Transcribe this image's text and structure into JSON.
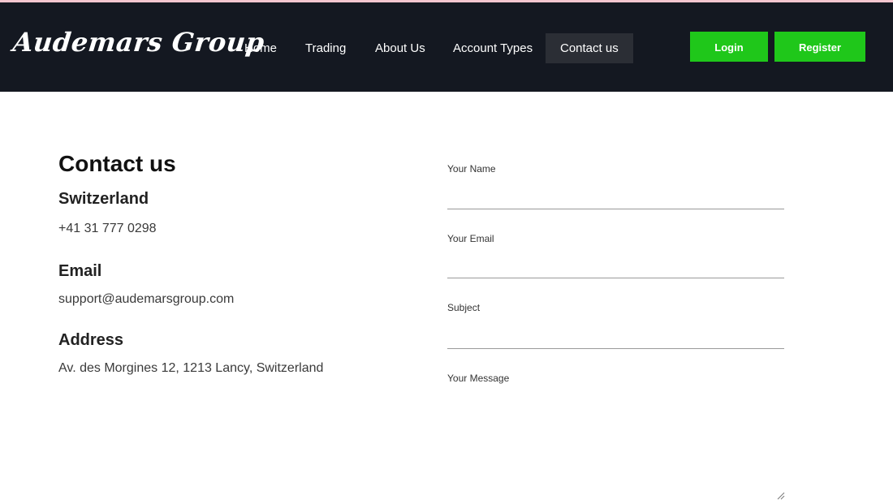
{
  "header": {
    "logo_text": "Audemars Group",
    "nav": [
      {
        "label": "Home",
        "active": false
      },
      {
        "label": "Trading",
        "active": false
      },
      {
        "label": "About Us",
        "active": false
      },
      {
        "label": "Account Types",
        "active": false
      },
      {
        "label": "Contact us",
        "active": true
      }
    ],
    "login_label": "Login",
    "register_label": "Register"
  },
  "contact": {
    "title": "Contact us",
    "location_heading": "Switzerland",
    "phone": "+41 31 777 0298",
    "email_heading": "Email",
    "email": "support@audemarsgroup.com",
    "address_heading": "Address",
    "address": "Av. des Morgines 12, 1213 Lancy, Switzerland"
  },
  "form": {
    "name_label": "Your Name",
    "name_value": "",
    "email_label": "Your Email",
    "email_value": "",
    "subject_label": "Subject",
    "subject_value": "",
    "message_label": "Your Message",
    "message_value": ""
  },
  "colors": {
    "navbar_bg": "#141821",
    "active_nav_bg": "#2b2e35",
    "button_green": "#1fc71a"
  }
}
